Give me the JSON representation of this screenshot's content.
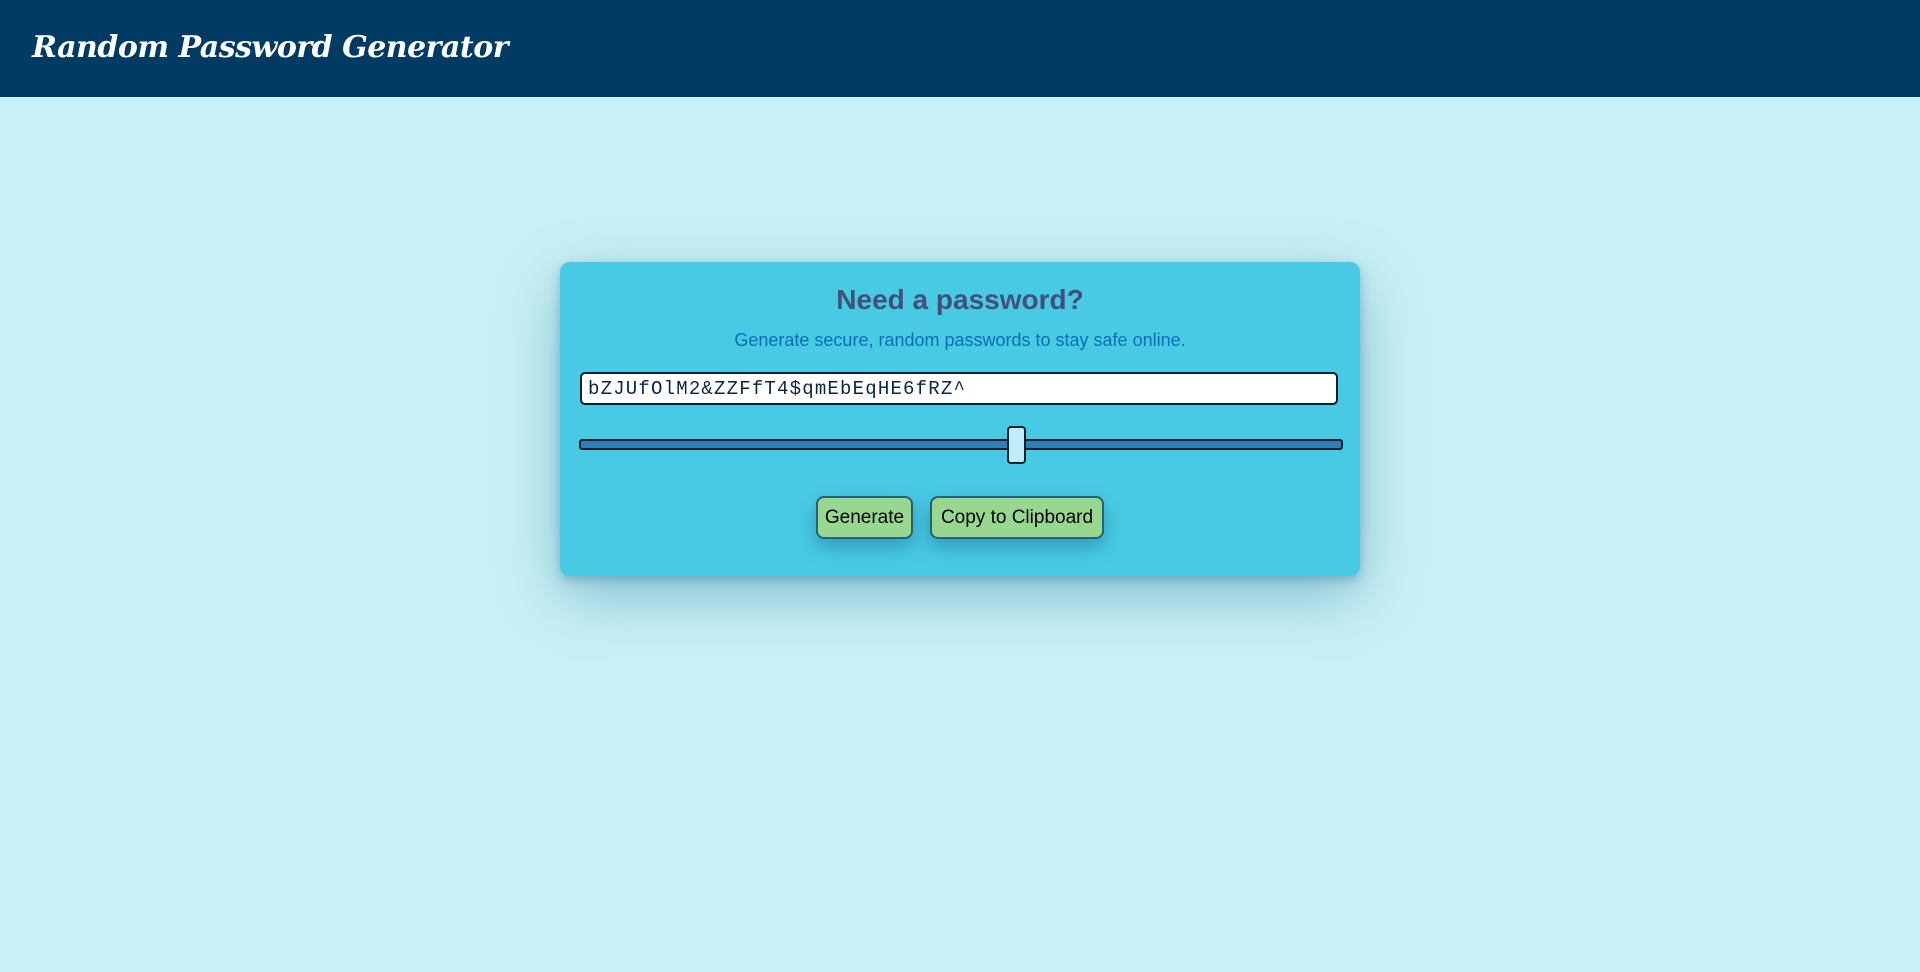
{
  "header": {
    "title": "Random Password Generator",
    "background": "#013a63"
  },
  "card": {
    "title": "Need a password?",
    "subtitle": "Generate secure, random passwords to stay safe online.",
    "background": "#48cae4"
  },
  "password": {
    "value": "bZJUfOlM2&ZZFfT4$qmEbEqHE6fRZ^"
  },
  "length_slider": {
    "level_fraction": 0.575
  },
  "buttons": {
    "generate_label": "Generate",
    "copy_label": "Copy to Clipboard",
    "color": "#97d78f"
  },
  "page": {
    "background": "#c9f0f6"
  }
}
